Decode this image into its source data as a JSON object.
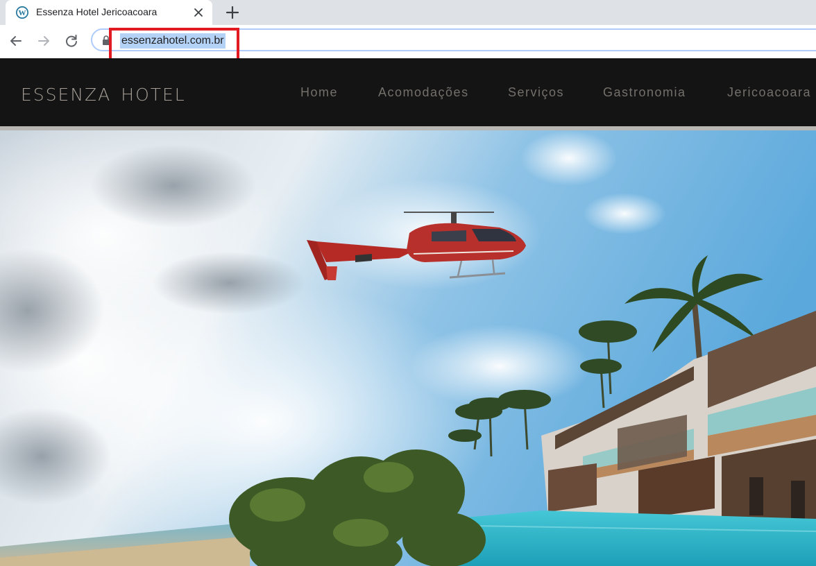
{
  "browser": {
    "tab": {
      "title": "Essenza Hotel Jericoacoara",
      "favicon": "wordpress-icon"
    },
    "address_bar": {
      "url": "essenzahotel.com.br"
    },
    "controls": [
      "back-arrow-icon",
      "forward-arrow-icon",
      "reload-icon",
      "lock-icon",
      "close-icon",
      "plus-icon"
    ],
    "highlight_color": "#e21a22"
  },
  "site": {
    "logo": {
      "word1": "ESSENZA",
      "word2": "HOTEL"
    },
    "nav": [
      {
        "label": "Home"
      },
      {
        "label": "Acomodações"
      },
      {
        "label": "Serviços"
      },
      {
        "label": "Gastronomia"
      },
      {
        "label": "Jericoacoara"
      }
    ],
    "colors": {
      "header_bg": "#141414",
      "nav_text": "#74706b",
      "logo_text": "#a59f97"
    }
  }
}
